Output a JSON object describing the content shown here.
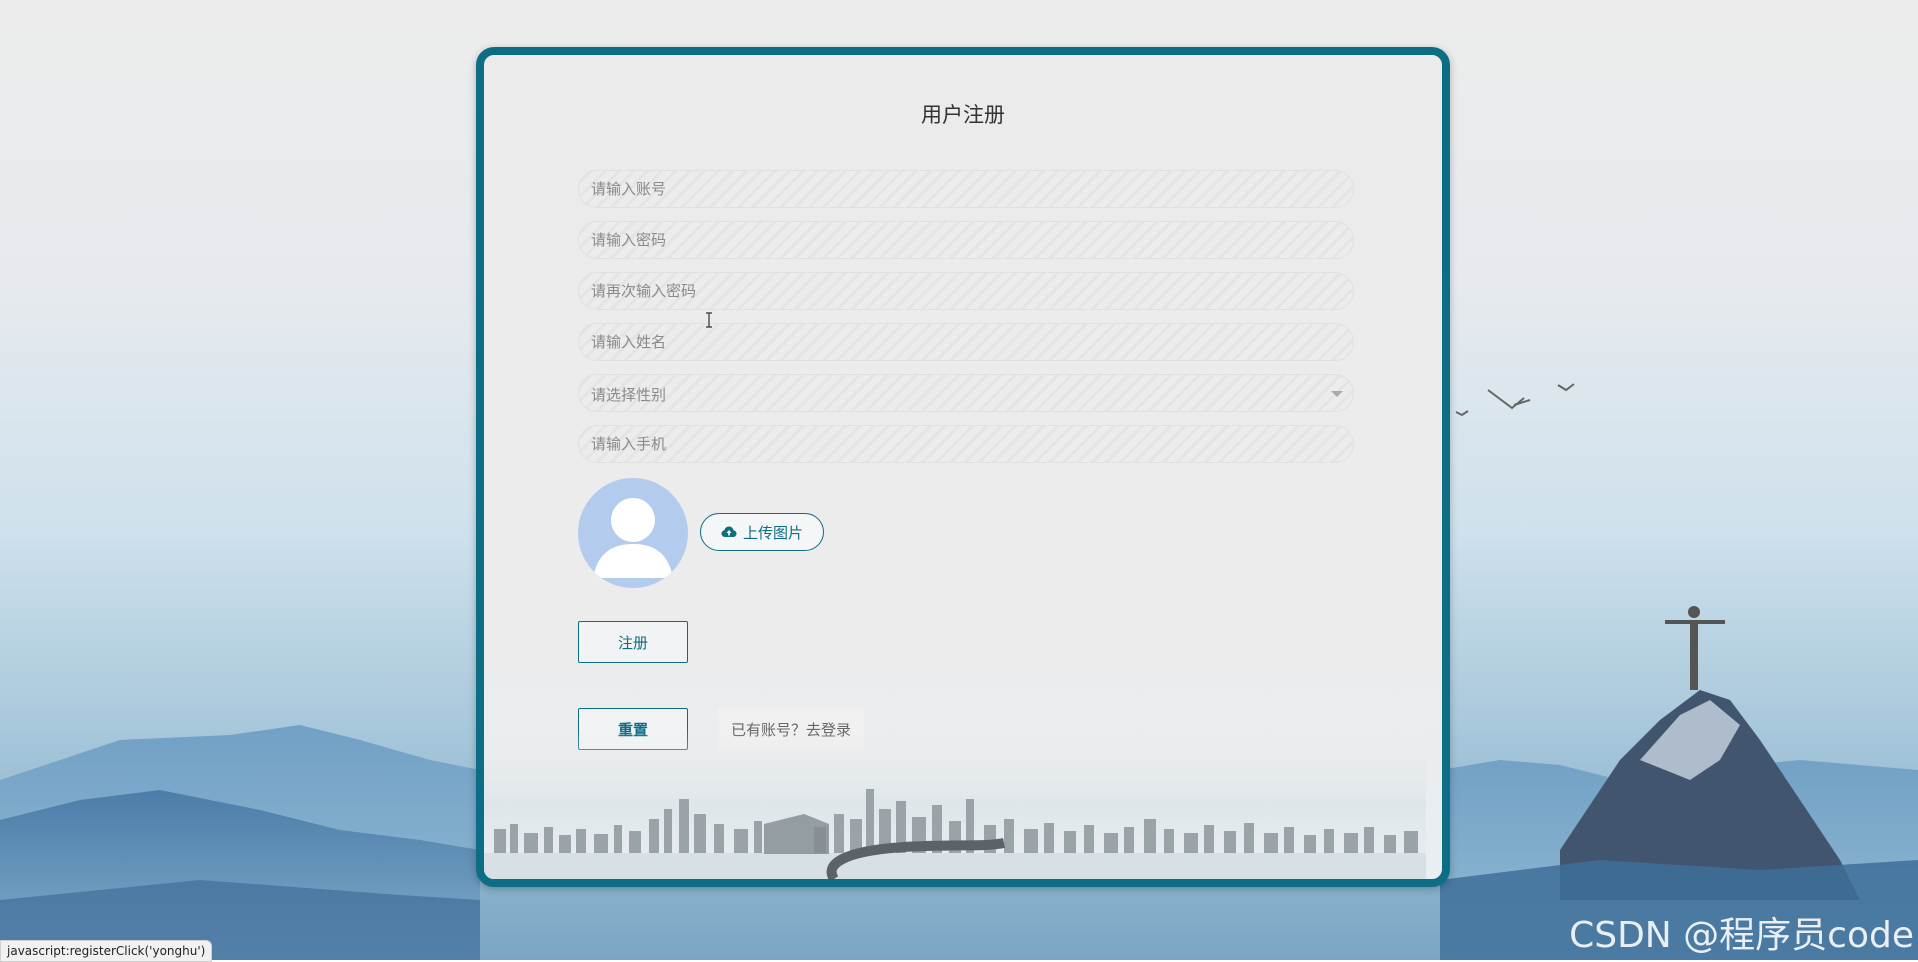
{
  "form": {
    "title": "用户注册",
    "fields": {
      "account": {
        "placeholder": "请输入账号",
        "value": ""
      },
      "password": {
        "placeholder": "请输入密码",
        "value": ""
      },
      "password_confirm": {
        "placeholder": "请再次输入密码",
        "value": ""
      },
      "name": {
        "placeholder": "请输入姓名",
        "value": ""
      },
      "gender": {
        "placeholder": "请选择性别"
      },
      "phone": {
        "placeholder": "请输入手机",
        "value": ""
      }
    },
    "upload_label": "上传图片",
    "register_label": "注册",
    "reset_label": "重置",
    "login_link": "已有账号？去登录"
  },
  "status_bar": "javascript:registerClick('yonghu')",
  "watermark": "CSDN @程序员code",
  "colors": {
    "accent": "#0d6d84",
    "avatar": "#b3cbec",
    "card_bg": "#ececec"
  }
}
